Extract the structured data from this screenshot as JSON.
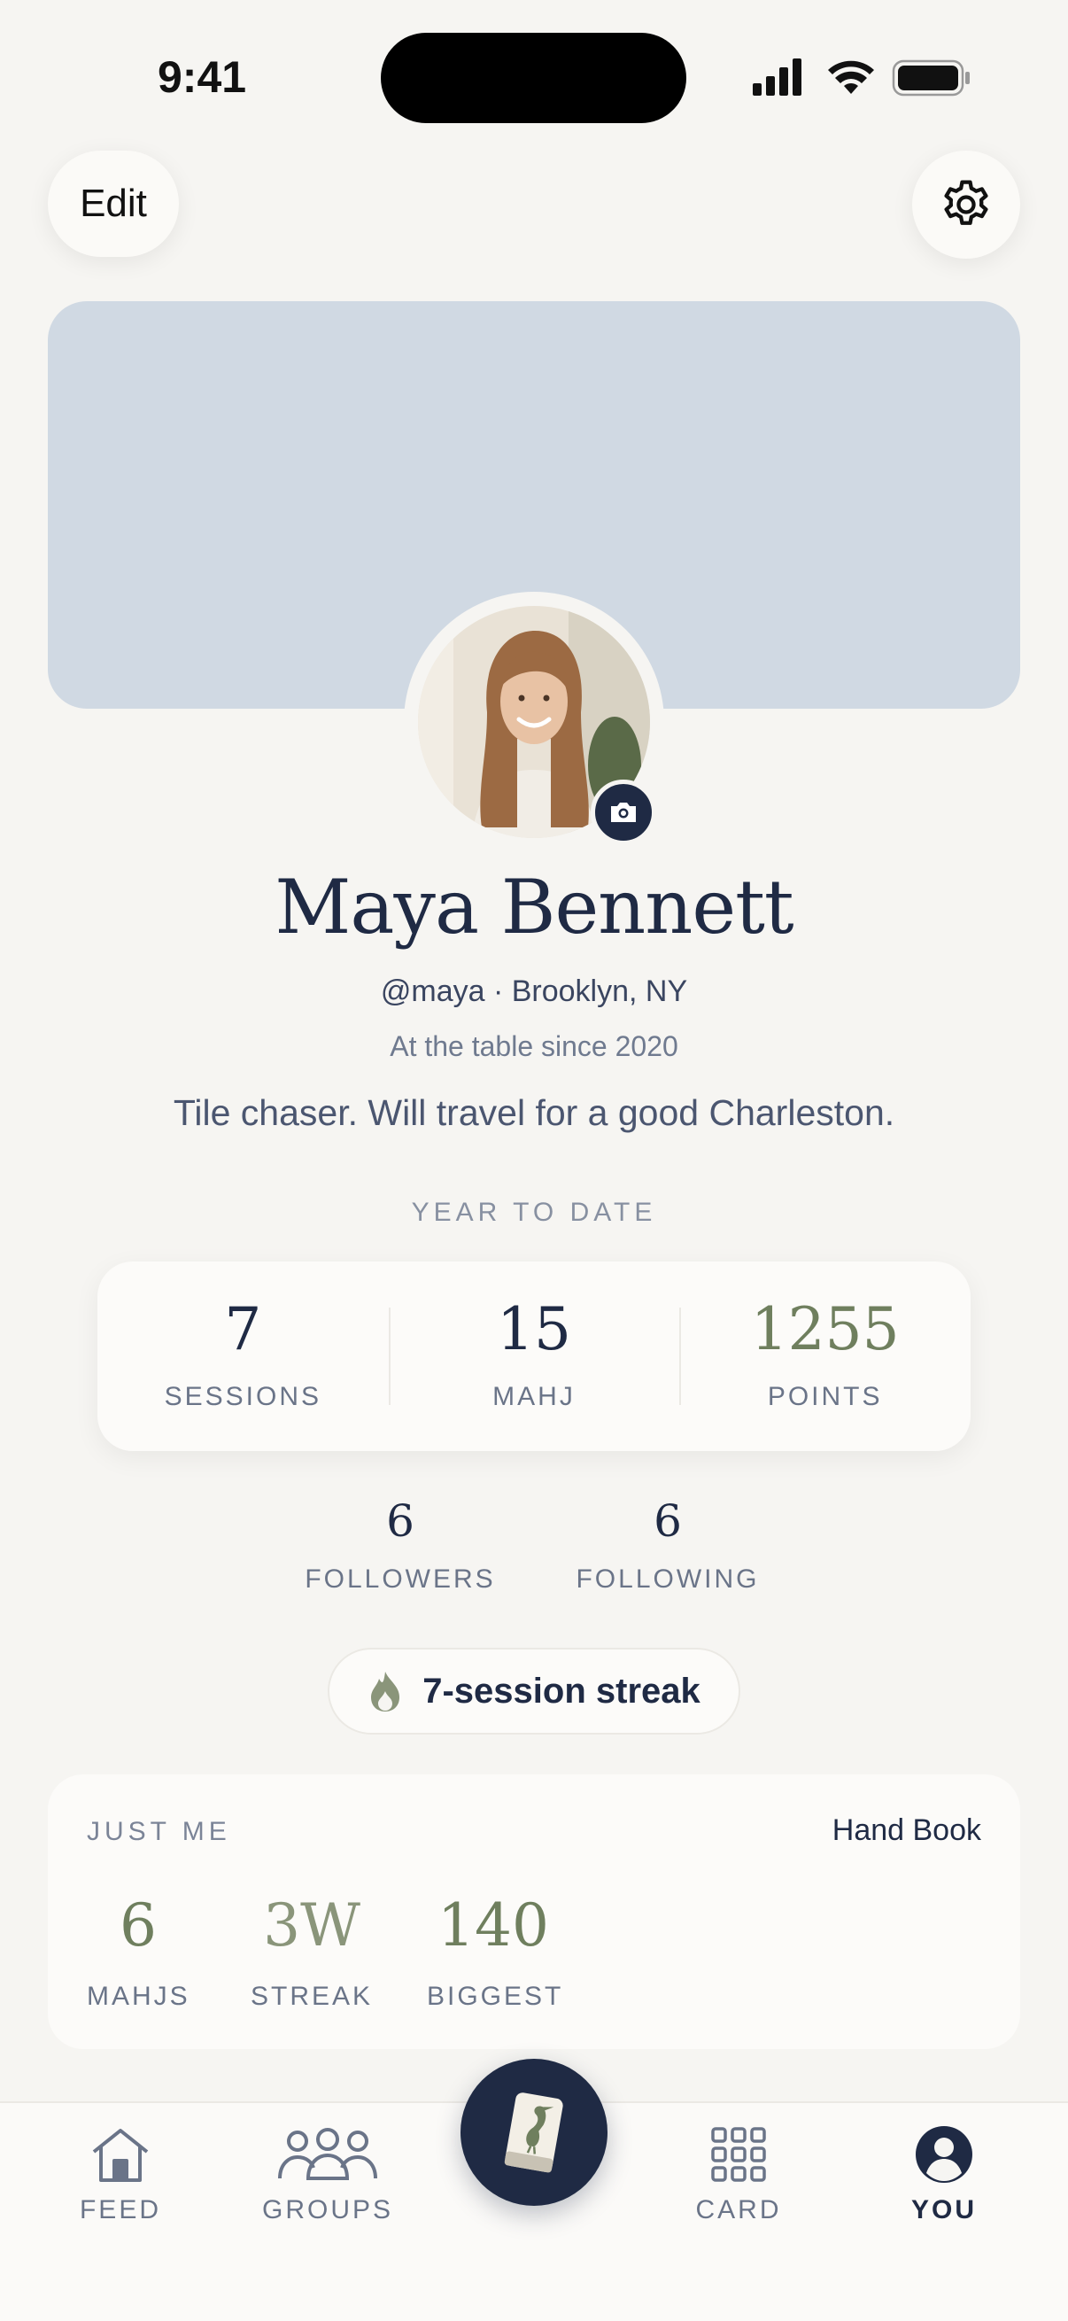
{
  "status_bar": {
    "time": "9:41"
  },
  "header": {
    "edit_label": "Edit"
  },
  "profile": {
    "name": "Maya Bennett",
    "handle_location": "@maya · Brooklyn, NY",
    "since": "At the table since 2020",
    "bio": "Tile chaser. Will travel for a good Charleston."
  },
  "ytd": {
    "label": "YEAR TO DATE",
    "stats": [
      {
        "value": "7",
        "label": "SESSIONS"
      },
      {
        "value": "15",
        "label": "MAHJ"
      },
      {
        "value": "1255",
        "label": "POINTS"
      }
    ]
  },
  "social": {
    "followers": {
      "value": "6",
      "label": "FOLLOWERS"
    },
    "following": {
      "value": "6",
      "label": "FOLLOWING"
    }
  },
  "streak": {
    "label": "7-session streak"
  },
  "just_me": {
    "label": "JUST ME",
    "link": "Hand Book",
    "stats": [
      {
        "value": "6",
        "label": "MAHJS"
      },
      {
        "value": "3W",
        "label": "STREAK"
      },
      {
        "value": "140",
        "label": "BIGGEST"
      }
    ]
  },
  "tabs": [
    {
      "label": "FEED",
      "icon": "home-icon"
    },
    {
      "label": "GROUPS",
      "icon": "groups-icon"
    },
    {
      "label": "",
      "icon": "tile-heron-icon"
    },
    {
      "label": "CARD",
      "icon": "grid-icon"
    },
    {
      "label": "YOU",
      "icon": "person-icon",
      "active": true
    }
  ],
  "colors": {
    "navy": "#1f2a44",
    "sage": "#6f7f5e",
    "cover": "#d0d9e3",
    "background": "#f6f5f2"
  }
}
